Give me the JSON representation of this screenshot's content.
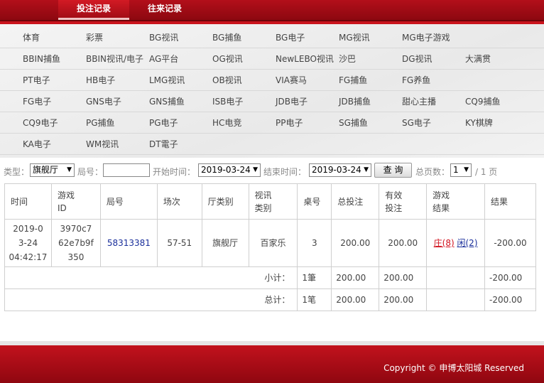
{
  "tabs": [
    {
      "label": "投注记录"
    },
    {
      "label": "往来记录"
    }
  ],
  "nav": {
    "rows": [
      [
        "体育",
        "彩票",
        "BG视讯",
        "BG捕鱼",
        "BG电子",
        "MG视讯",
        "MG电子游戏",
        ""
      ],
      [
        "BBIN捕鱼",
        "BBIN视讯/电子",
        "AG平台",
        "OG视讯",
        "NewLEBO视讯",
        "沙巴",
        "DG视讯",
        "大满贯"
      ],
      [
        "PT电子",
        "HB电子",
        "LMG视讯",
        "OB视讯",
        "VIA赛马",
        "FG捕鱼",
        "FG养鱼",
        ""
      ],
      [
        "FG电子",
        "GNS电子",
        "GNS捕鱼",
        "ISB电子",
        "JDB电子",
        "JDB捕鱼",
        "甜心主播",
        "CQ9捕鱼"
      ],
      [
        "CQ9电子",
        "PG捕鱼",
        "PG电子",
        "HC电竞",
        "PP电子",
        "SG捕鱼",
        "SG电子",
        "KY棋牌"
      ],
      [
        "KA电子",
        "WM视讯",
        "DT電子",
        "",
        "",
        "",
        "",
        ""
      ]
    ]
  },
  "filter": {
    "type_label": "类型：",
    "type_value": "旗舰厅",
    "round_label": "局号：",
    "start_label": "开始时间：",
    "start_value": "2019-03-24",
    "end_label": "结束时间：",
    "end_value": "2019-03-24",
    "query_label": "查 询",
    "pages_label": "总页数：",
    "page_value": "1",
    "page_total": "/ 1 页"
  },
  "table": {
    "headers": [
      "时间",
      "游戏ID",
      "局号",
      "场次",
      "厅类别",
      "视讯类别",
      "桌号",
      "总投注",
      "有效投注",
      "游戏结果",
      "结果"
    ],
    "row": {
      "time_date": "2019-03-24",
      "time_clock": "04:42:17",
      "game_id": "3970c762e7b9f350",
      "round": "58313381",
      "session": "57-51",
      "hall": "旗舰厅",
      "video_type": "百家乐",
      "table_no": "3",
      "total_bet": "200.00",
      "valid_bet": "200.00",
      "result_banker": "庄(8)",
      "result_player": "闲(2)",
      "outcome": "-200.00"
    },
    "subtotal": {
      "label": "小计：",
      "count": "1筆",
      "total_bet": "200.00",
      "valid_bet": "200.00",
      "outcome": "-200.00"
    },
    "total": {
      "label": "总计：",
      "count": "1笔",
      "total_bet": "200.00",
      "valid_bet": "200.00",
      "outcome": "-200.00"
    }
  },
  "footer": {
    "copyright": "Copyright © 申博太阳城 Reserved"
  }
}
